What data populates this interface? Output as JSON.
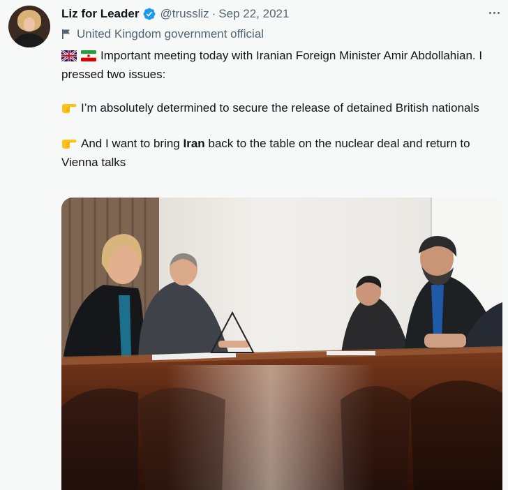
{
  "author": {
    "name": "Liz for Leader",
    "handle": "@trussliz",
    "separator": "·",
    "date": "Sep 22, 2021",
    "label": "United Kingdom government official"
  },
  "icons": {
    "verified": "verified-badge-icon",
    "more": "more-options-icon",
    "label": "flag-icon",
    "emoji_flags": [
      "uk-flag-emoji",
      "iran-flag-emoji"
    ],
    "emoji_pointing": "pointing-right-emoji"
  },
  "tweet": {
    "line1": "Important meeting today with Iranian Foreign Minister Amir Abdollahian. I pressed two issues:",
    "point1": "I’m absolutely determined to secure the release of detained British nationals",
    "point2_pre": "And I want to bring ",
    "point2_bold": "Iran",
    "point2_post": " back to the table on the nuclear deal and return to Vienna talks"
  },
  "colors": {
    "background": "#f7f9f9",
    "text": "#0f1419",
    "secondary": "#536471",
    "verified": "#1d9bf0"
  }
}
